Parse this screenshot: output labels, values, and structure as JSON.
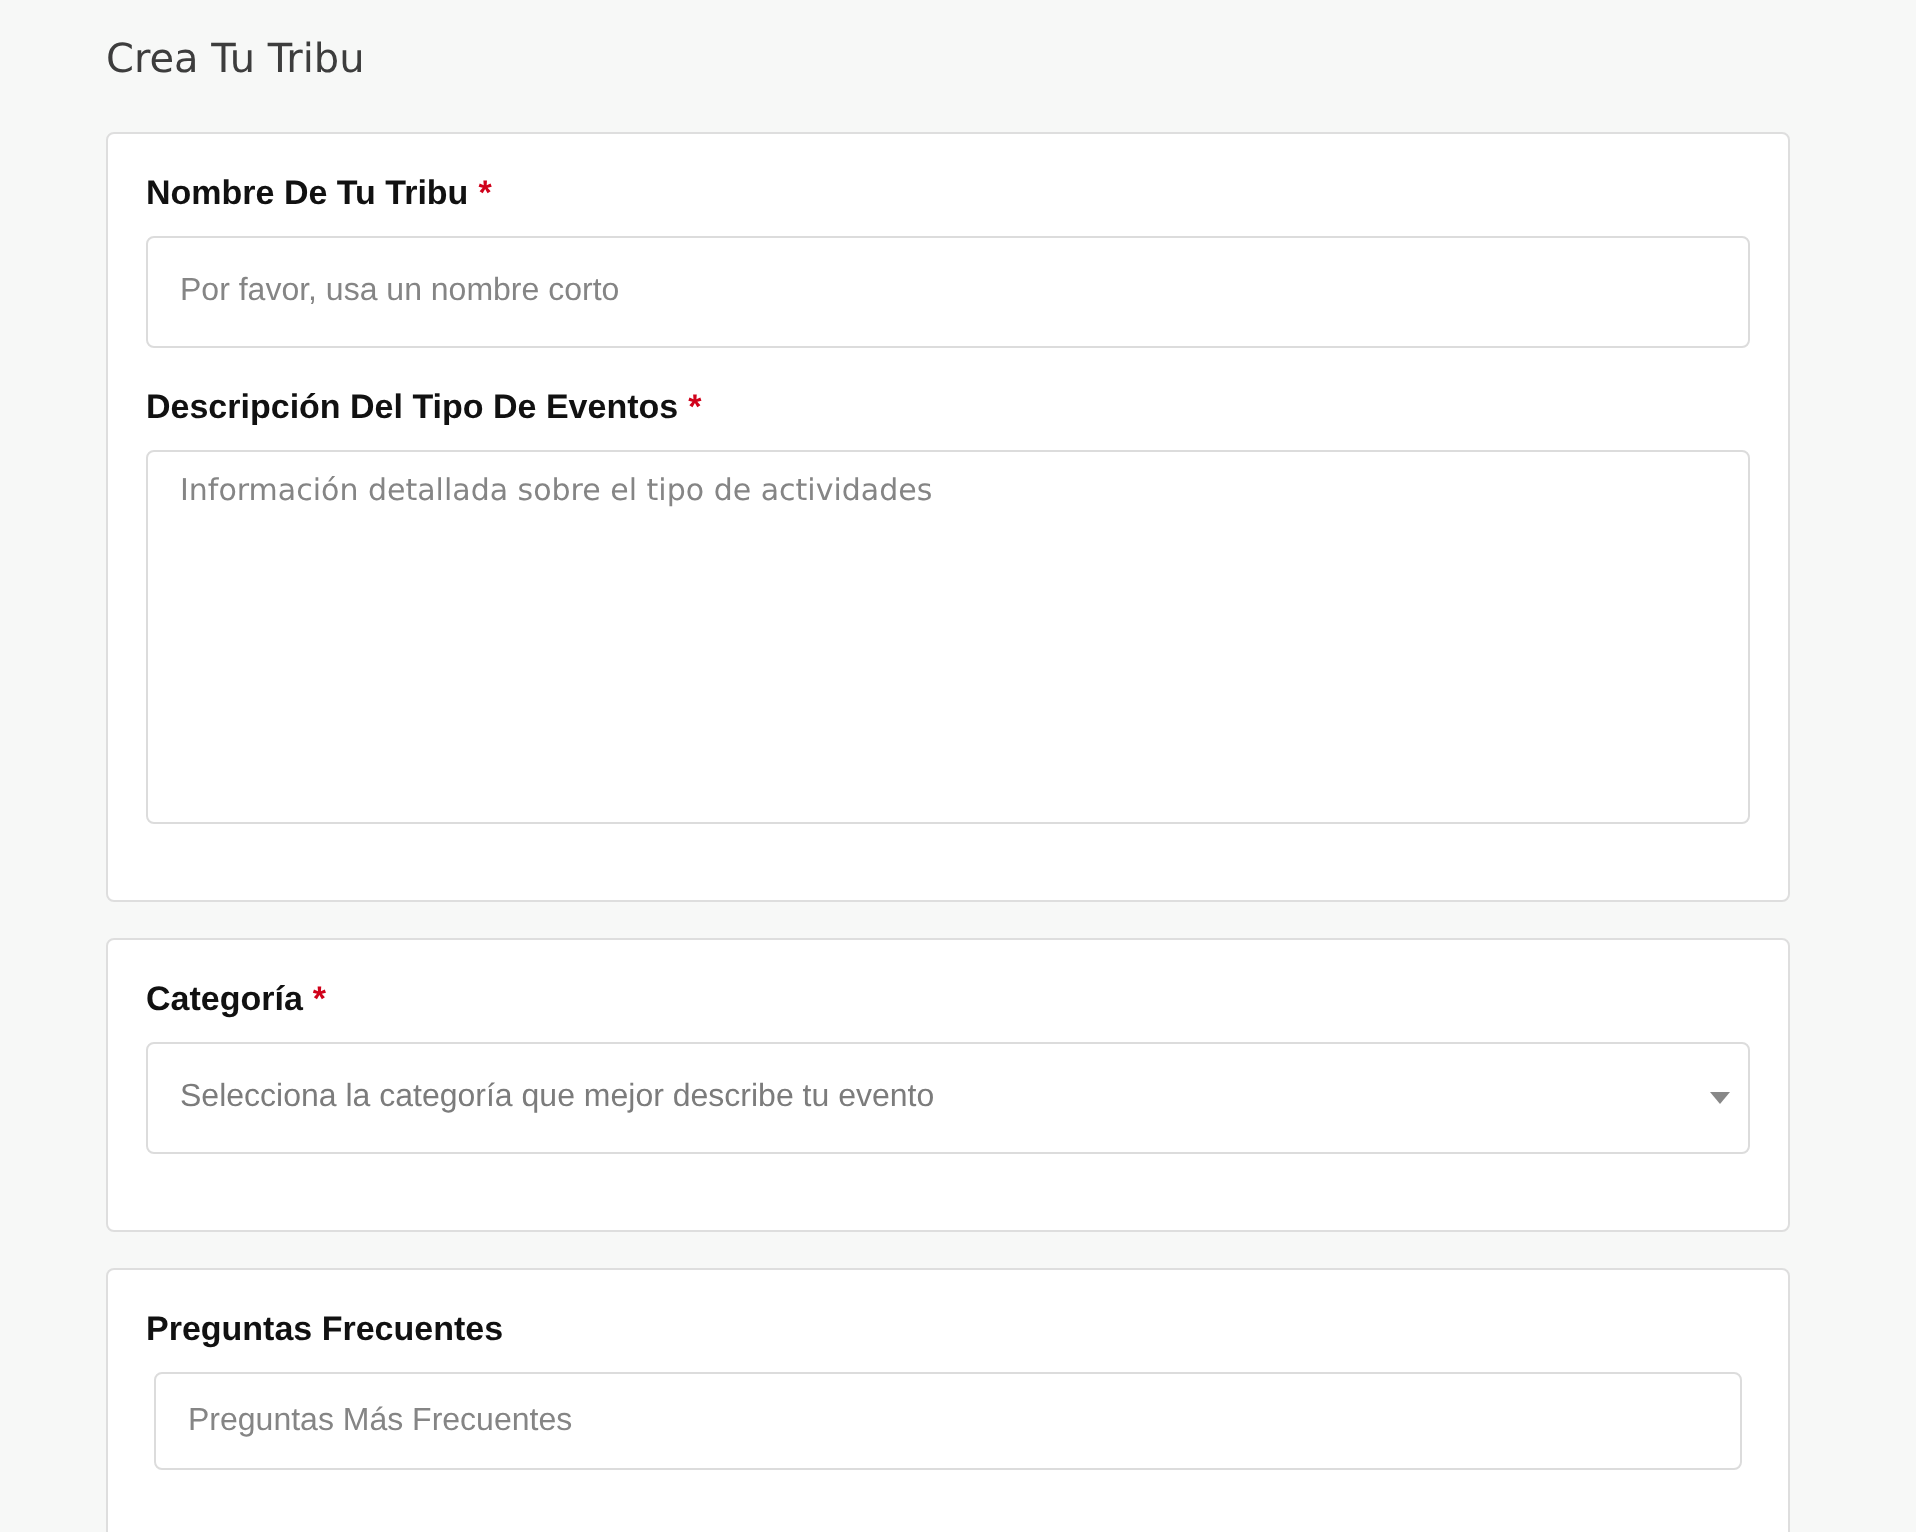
{
  "page": {
    "title": "Crea Tu Tribu"
  },
  "required_marker": "*",
  "sections": [
    {
      "fields": [
        {
          "kind": "text",
          "label": "Nombre De Tu Tribu",
          "required": true,
          "placeholder": "Por favor, usa un nombre corto"
        },
        {
          "kind": "textarea",
          "label": "Descripción Del Tipo De Eventos",
          "required": true,
          "placeholder": "Información detallada sobre el tipo de actividades"
        }
      ]
    },
    {
      "fields": [
        {
          "kind": "select",
          "label": "Categoría",
          "required": true,
          "placeholder": "Selecciona la categoría que mejor describe tu evento"
        }
      ]
    },
    {
      "fields": [
        {
          "kind": "faq",
          "label": "Preguntas Frecuentes",
          "required": false,
          "placeholder": "Preguntas Más Frecuentes"
        }
      ]
    }
  ]
}
